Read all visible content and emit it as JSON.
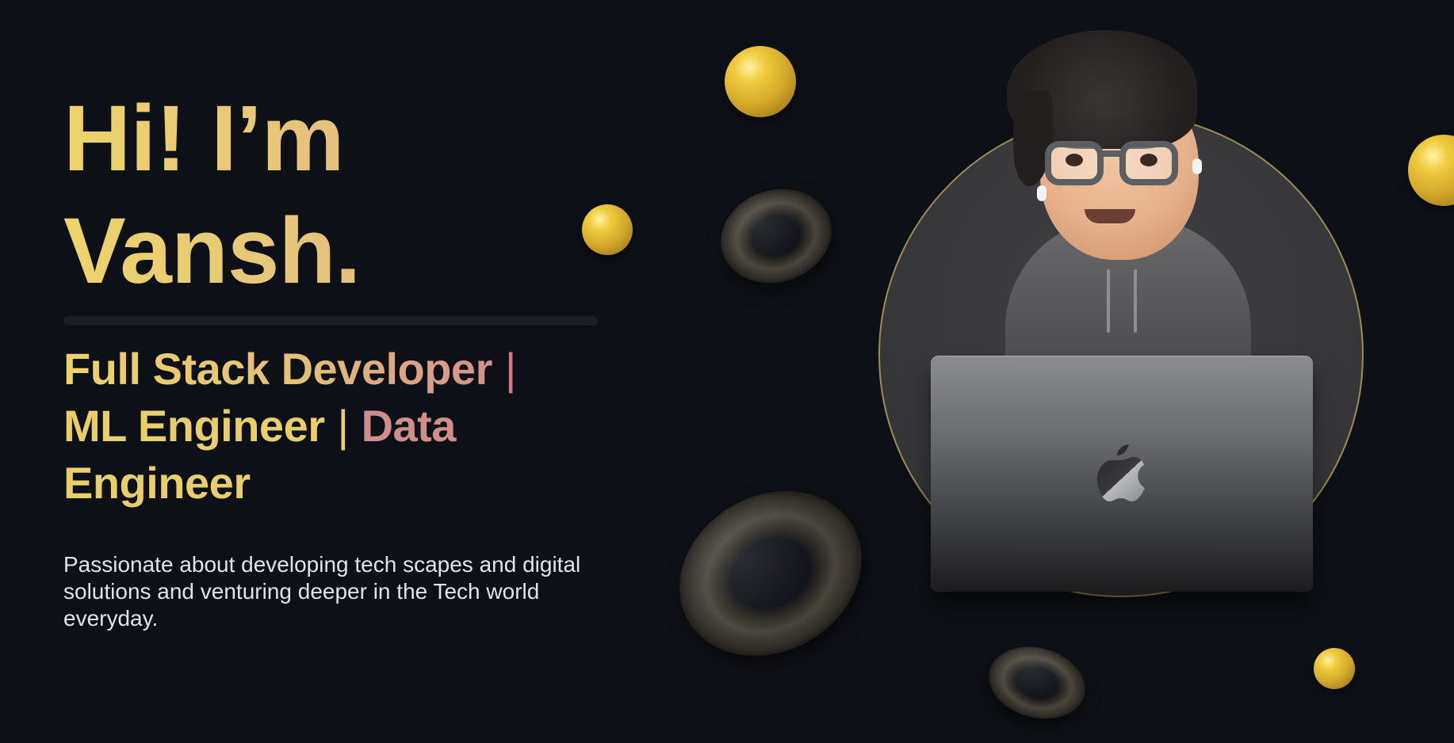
{
  "hero": {
    "greeting": "Hi! I’m",
    "name": "Vansh."
  },
  "roles": {
    "line1_a": "Full Stack Developer",
    "line1_sep": "|",
    "line2_a": "ML Engineer",
    "line2_sep": "|",
    "line2_b": "Data",
    "line3": "Engineer"
  },
  "tagline": "Passionate about developing tech scapes and digital solutions and venturing deeper in the Tech world everyday.",
  "colors": {
    "background": "#0d1016",
    "accent_gold": "#e8cf6a",
    "accent_pink": "#d08d8b",
    "text_body": "#dfe3ea"
  },
  "icons": {
    "avatar": "memoji-avatar-with-laptop",
    "laptop_logo": "apple-logo-icon"
  }
}
